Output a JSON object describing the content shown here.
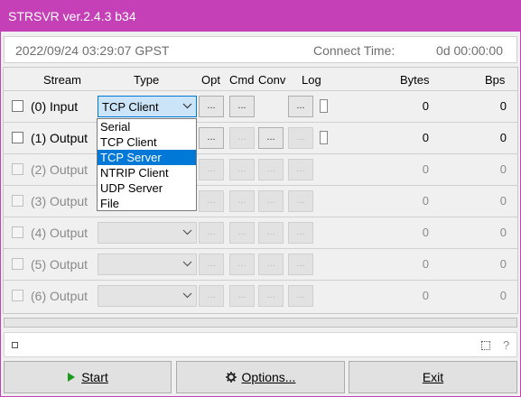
{
  "window": {
    "title": "STRSVR ver.2.4.3 b34"
  },
  "timebar": {
    "time": "2022/09/24 03:29:07 GPST",
    "connect_label": "Connect Time:",
    "connect_value": "0d 00:00:00"
  },
  "headers": {
    "stream": "Stream",
    "type": "Type",
    "opt": "Opt",
    "cmd": "Cmd",
    "conv": "Conv",
    "log": "Log",
    "bytes": "Bytes",
    "bps": "Bps"
  },
  "button_glyph": "...",
  "rows": [
    {
      "label": "(0) Input",
      "type": "TCP Client",
      "bytes": "0",
      "bps": "0"
    },
    {
      "label": "(1) Output",
      "type": "",
      "bytes": "0",
      "bps": "0"
    },
    {
      "label": "(2) Output",
      "type": "",
      "bytes": "0",
      "bps": "0"
    },
    {
      "label": "(3) Output",
      "type": "",
      "bytes": "0",
      "bps": "0"
    },
    {
      "label": "(4) Output",
      "type": "",
      "bytes": "0",
      "bps": "0"
    },
    {
      "label": "(5) Output",
      "type": "",
      "bytes": "0",
      "bps": "0"
    },
    {
      "label": "(6) Output",
      "type": "",
      "bytes": "0",
      "bps": "0"
    }
  ],
  "dropdown": {
    "options": [
      "Serial",
      "TCP Client",
      "TCP Server",
      "NTRIP Client",
      "UDP Server",
      "File"
    ],
    "highlighted": "TCP Server"
  },
  "status": {
    "help": "?"
  },
  "buttons": {
    "start": {
      "label": "Start",
      "icon": "play-icon"
    },
    "options": {
      "label": "Options...",
      "icon": "gear-icon"
    },
    "exit": {
      "label": "Exit"
    }
  },
  "colors": {
    "titlebar": "#c53fb6",
    "selection": "#0078d7",
    "start_icon": "#1a9a1a"
  }
}
